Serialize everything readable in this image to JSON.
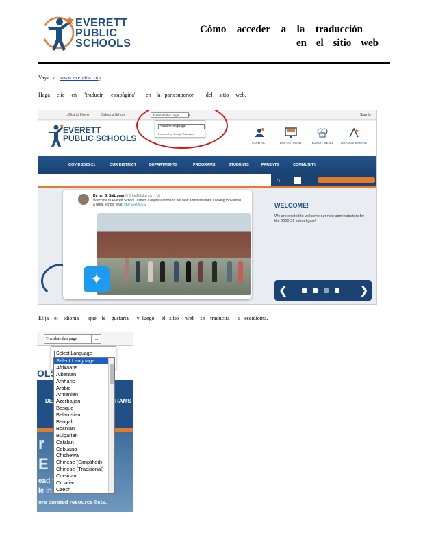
{
  "header": {
    "logo_lines": [
      "EVERETT",
      "PUBLIC",
      "SCHOOLS"
    ],
    "title_line1": [
      "Cómo",
      "acceder",
      "a",
      "la",
      "traducción"
    ],
    "title_line2": [
      "en",
      "el",
      "sitio",
      "web"
    ]
  },
  "step1": {
    "words": [
      "Vaya",
      "a"
    ],
    "link": "www.everettsd.org"
  },
  "step2": {
    "words": [
      "Haga",
      "clic",
      "en",
      "\"traducir",
      "estapágina\"",
      "en",
      "la",
      "partesuperior",
      "del",
      "sitio",
      "web."
    ]
  },
  "step3": {
    "words": [
      "Elija",
      "el",
      "idioma",
      "que",
      "le",
      "gustaría",
      "y",
      "luego",
      "el",
      "sitio",
      "web",
      "se",
      "traducirá",
      "a",
      "eseidioma."
    ]
  },
  "shot1": {
    "topbar": {
      "district_home": "District Home",
      "select_school": "Select a School",
      "translate": "Translate this page",
      "signin": "Sign In"
    },
    "dropdown": {
      "select": "Select Language",
      "powered": "Powered by Google Translate"
    },
    "logo_lines": [
      "EVERETT",
      "PUBLIC SCHOOLS"
    ],
    "quick_links": [
      "CONTACT",
      "EMPLOYMENT",
      "LUNCH MENU",
      "GRADES 5 MORE"
    ],
    "nav": [
      "COVID 2020-21",
      "OUR DISTRICT",
      "DEPARTMENTS",
      "PROGRAMS",
      "STUDENTS",
      "PARENTS",
      "COMMUNITY"
    ],
    "tweet": {
      "name": "Dr. Ian B. Saltzman",
      "handle": "@DrIanBSaltzman · 1h",
      "text": "Welcome to Everett School District! Congratulations to our new administrators! Looking forward to a great school year.",
      "tag": "#EPS ROCKS"
    },
    "welcome_title": "WELCOME!",
    "welcome_text": "We are excited to welcome our new administrators for the 2020-21 school year!"
  },
  "shot2": {
    "translate": "Translate this page",
    "select": "Select Language",
    "banner_lines": [
      "r b 20",
      "E t  /E",
      "ead fo",
      "le in t",
      "ore curated resource lists."
    ],
    "nav_fragment": [
      "DEI",
      "RAMS"
    ],
    "languages": [
      "Select Language",
      "Afrikaans",
      "Albanian",
      "Amharic",
      "Arabic",
      "Armenian",
      "Azerbaijani",
      "Basque",
      "Belarusian",
      "Bengali",
      "Bosnian",
      "Bulgarian",
      "Catalan",
      "Cebuano",
      "Chichewa",
      "Chinese (Simplified)",
      "Chinese (Traditional)",
      "Corsican",
      "Croatian",
      "Czech"
    ]
  }
}
